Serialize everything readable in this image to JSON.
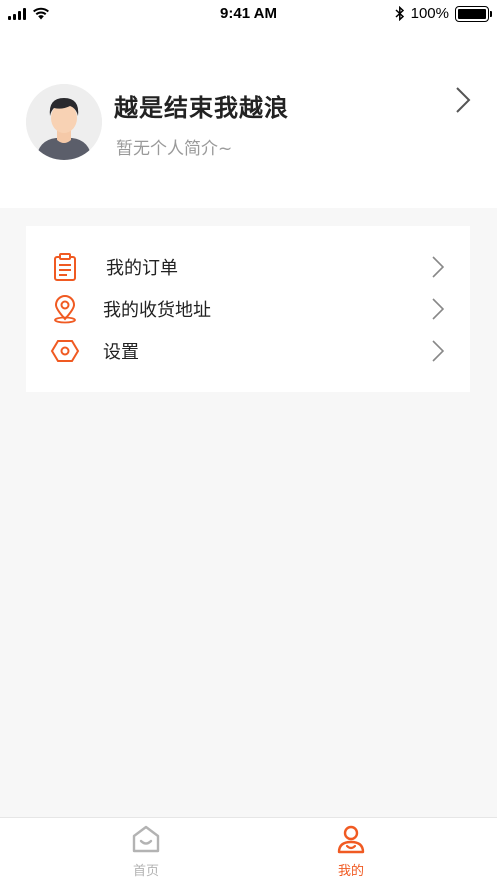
{
  "status_bar": {
    "time": "9:41 AM",
    "battery": "100%",
    "icons": [
      "signal-icon",
      "wifi-icon",
      "bluetooth-icon",
      "battery-icon"
    ]
  },
  "profile": {
    "name": "越是结束我越浪",
    "bio": "暂无个人简介~",
    "avatar_icon": "avatar"
  },
  "menu": {
    "items": [
      {
        "label": "我的订单",
        "icon": "clipboard-icon"
      },
      {
        "label": "我的收货地址",
        "icon": "location-pin-icon"
      },
      {
        "label": "设置",
        "icon": "settings-hexagon-icon"
      }
    ]
  },
  "tab_bar": {
    "tabs": [
      {
        "label": "首页",
        "icon": "home-icon",
        "active": false
      },
      {
        "label": "我的",
        "icon": "profile-icon",
        "active": true
      }
    ]
  },
  "colors": {
    "accent": "#f05a22",
    "inactive": "#b3b3b3",
    "background": "#f7f7f7"
  }
}
